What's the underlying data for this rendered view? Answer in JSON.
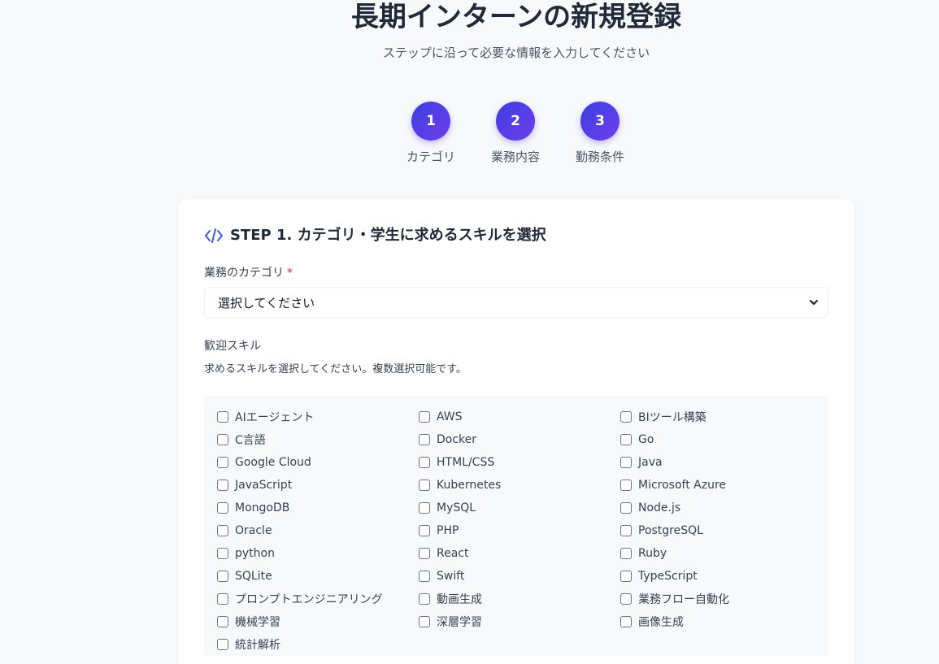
{
  "header": {
    "title": "長期インターンの新規登録",
    "subtitle": "ステップに沿って必要な情報を入力してください"
  },
  "steps": [
    {
      "number": "1",
      "label": "カテゴリ"
    },
    {
      "number": "2",
      "label": "業務内容"
    },
    {
      "number": "3",
      "label": "勤務条件"
    }
  ],
  "form": {
    "section_title": "STEP 1. カテゴリ・学生に求めるスキルを選択",
    "category_label": "業務のカテゴリ",
    "required_mark": "*",
    "category_value": "選択してください",
    "skills_label": "歓迎スキル",
    "skills_help": "求めるスキルを選択してください。複数選択可能です。",
    "skills": [
      "AIエージェント",
      "AWS",
      "BIツール構築",
      "C言語",
      "Docker",
      "Go",
      "Google Cloud",
      "HTML/CSS",
      "Java",
      "JavaScript",
      "Kubernetes",
      "Microsoft Azure",
      "MongoDB",
      "MySQL",
      "Node.js",
      "Oracle",
      "PHP",
      "PostgreSQL",
      "python",
      "React",
      "Ruby",
      "SQLite",
      "Swift",
      "TypeScript",
      "プロンプトエンジニアリング",
      "動画生成",
      "業務フロー自動化",
      "機械学習",
      "深層学習",
      "画像生成",
      "統計解析"
    ]
  },
  "colors": {
    "accent": "#4f46e5",
    "required": "#dc2626"
  },
  "icons": {
    "section": "code-icon",
    "select": "chevron-down-icon"
  }
}
